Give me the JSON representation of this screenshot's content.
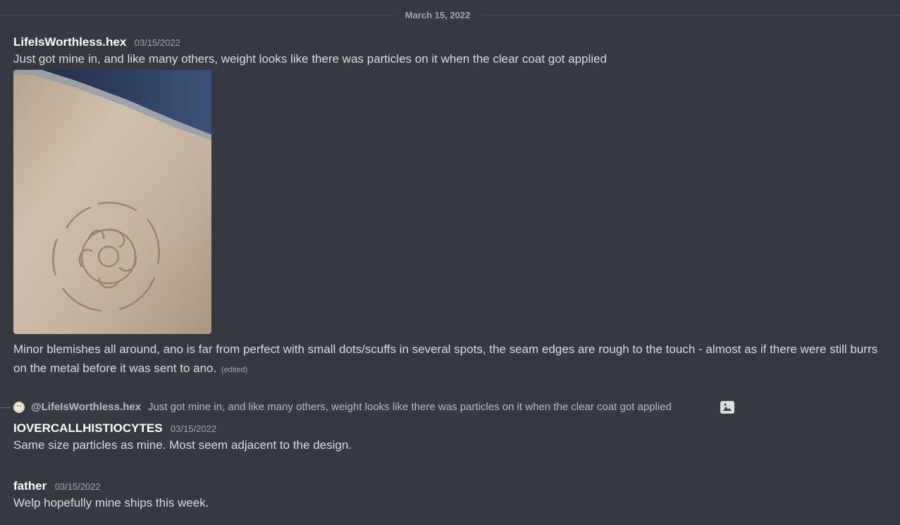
{
  "divider": {
    "date": "March 15, 2022"
  },
  "messages": [
    {
      "username": "LifeIsWorthless.hex",
      "timestamp": "03/15/2022",
      "text": "Just got mine in, and like many others, weight looks like there was particles on it when the clear coat got applied",
      "attachment_icon": "image-attachment",
      "followup_text": "Minor blemishes all around, ano is far from perfect with small dots/scuffs in several spots, the seam edges are rough to the touch - almost as if there were still burrs on the metal before it was sent to ano.",
      "edited_label": "(edited)"
    },
    {
      "reply": {
        "mention": "@LifeIsWorthless.hex",
        "text": "Just got mine in, and like many others, weight looks like there was particles on it when the clear coat got applied",
        "icon": "image-icon"
      },
      "username": "IOVERCALLHISTIOCYTES",
      "timestamp": "03/15/2022",
      "text": "Same size particles as mine. Most seem adjacent to the design."
    },
    {
      "username": "father",
      "timestamp": "03/15/2022",
      "text": "Welp hopefully mine ships this week."
    }
  ],
  "colors": {
    "background": "#36393f",
    "username": "#ffffff",
    "text": "#dcddde",
    "muted": "#a3a6aa"
  }
}
